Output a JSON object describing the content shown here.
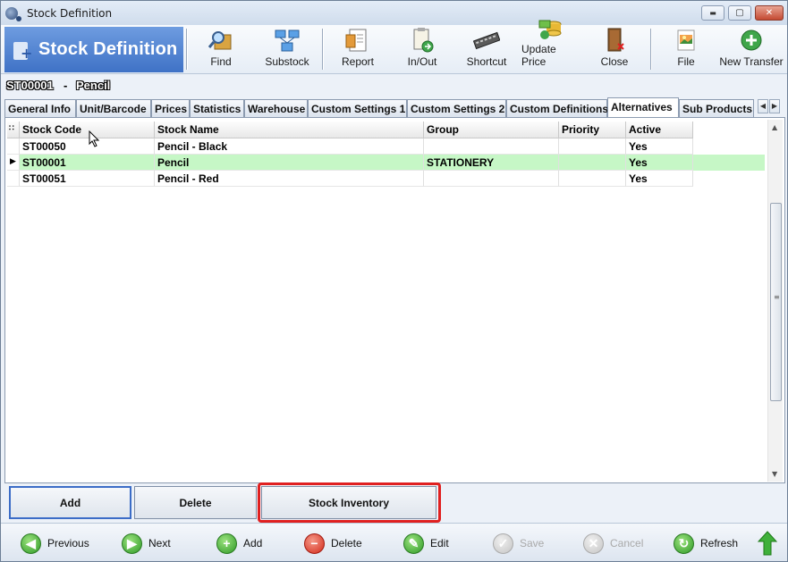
{
  "window": {
    "title": "Stock Definition",
    "controls": {
      "minimize": "▬",
      "maximize": "▢",
      "close": "✕"
    }
  },
  "toolbar": {
    "banner_title": "Stock Definition",
    "buttons": [
      {
        "label": "Find",
        "icon": "find-icon"
      },
      {
        "label": "Substock",
        "icon": "substock-icon"
      },
      {
        "label": "Report",
        "icon": "report-icon"
      },
      {
        "label": "In/Out",
        "icon": "in-out-icon"
      },
      {
        "label": "Shortcut",
        "icon": "shortcut-icon"
      },
      {
        "label": "Update Price",
        "icon": "update-price-icon"
      },
      {
        "label": "Close",
        "icon": "close-door-icon"
      },
      {
        "label": "File",
        "icon": "file-icon"
      },
      {
        "label": "New Transfer",
        "icon": "new-transfer-icon"
      }
    ]
  },
  "record": {
    "code": "ST00001",
    "separator": "-",
    "name": "Pencil"
  },
  "tabs": [
    {
      "label": "General Info"
    },
    {
      "label": "Unit/Barcode"
    },
    {
      "label": "Prices"
    },
    {
      "label": "Statistics"
    },
    {
      "label": "Warehouse"
    },
    {
      "label": "Custom Settings 1"
    },
    {
      "label": "Custom Settings 2"
    },
    {
      "label": "Custom Definitions"
    },
    {
      "label": "Alternatives",
      "active": true
    },
    {
      "label": "Sub Products"
    }
  ],
  "grid": {
    "columns": [
      "Stock Code",
      "Stock Name",
      "Group",
      "Priority",
      "Active"
    ],
    "rows": [
      {
        "code": "ST00050",
        "name": "Pencil - Black",
        "group": "",
        "priority": "",
        "active": "Yes"
      },
      {
        "code": "ST00001",
        "name": "Pencil",
        "group": "STATIONERY",
        "priority": "",
        "active": "Yes",
        "selected": true
      },
      {
        "code": "ST00051",
        "name": "Pencil - Red",
        "group": "",
        "priority": "",
        "active": "Yes"
      }
    ],
    "selected_color": "#c6f7c6"
  },
  "actions": {
    "add": "Add",
    "delete": "Delete",
    "stock_inventory": "Stock Inventory"
  },
  "nav": {
    "previous": "Previous",
    "next": "Next",
    "add": "Add",
    "delete": "Delete",
    "edit": "Edit",
    "save": "Save",
    "cancel": "Cancel",
    "refresh": "Refresh"
  },
  "colors": {
    "accent": "#3f72c6",
    "highlight_border": "#e02020"
  }
}
